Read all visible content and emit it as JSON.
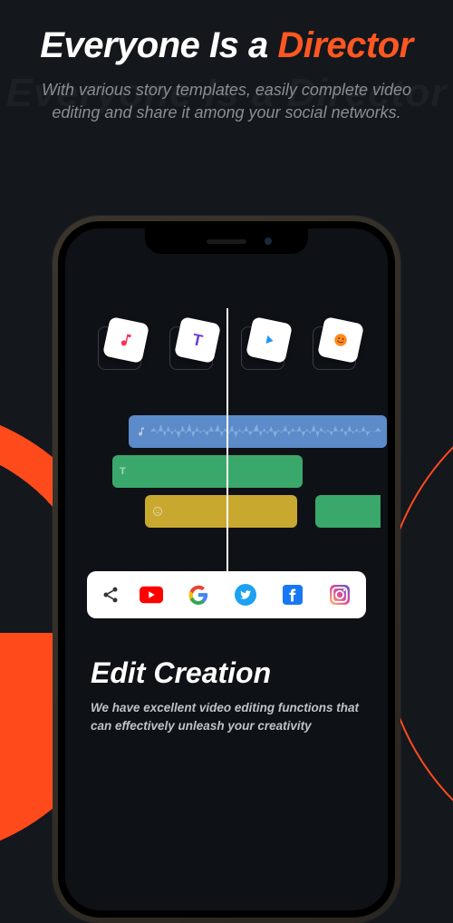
{
  "hero": {
    "title_pre": "Everyone Is a ",
    "title_accent": "Director",
    "shadow": "Everyone Is a Director",
    "subtitle": "With various story templates, easily complete video editing and share it among your social networks."
  },
  "tools": [
    {
      "name": "music-icon",
      "color": "#ff3355"
    },
    {
      "name": "text-icon",
      "color": "#6b3fd6",
      "label": "T"
    },
    {
      "name": "play-icon",
      "color": "#2196f3"
    },
    {
      "name": "sticker-icon",
      "color": "#ff8a1c"
    }
  ],
  "tracks": {
    "audio": {
      "name": "audio-track"
    },
    "text1": {
      "name": "text-track",
      "label": "T"
    },
    "text2": {
      "name": "text-track-2"
    },
    "sticker": {
      "name": "sticker-track"
    }
  },
  "share": {
    "button": "share-icon",
    "platforms": [
      {
        "name": "youtube-icon"
      },
      {
        "name": "google-icon"
      },
      {
        "name": "twitter-icon"
      },
      {
        "name": "facebook-icon"
      },
      {
        "name": "instagram-icon"
      }
    ]
  },
  "section": {
    "title": "Edit Creation",
    "body": "We have excellent video editing functions that can effectively unleash your creativity"
  }
}
